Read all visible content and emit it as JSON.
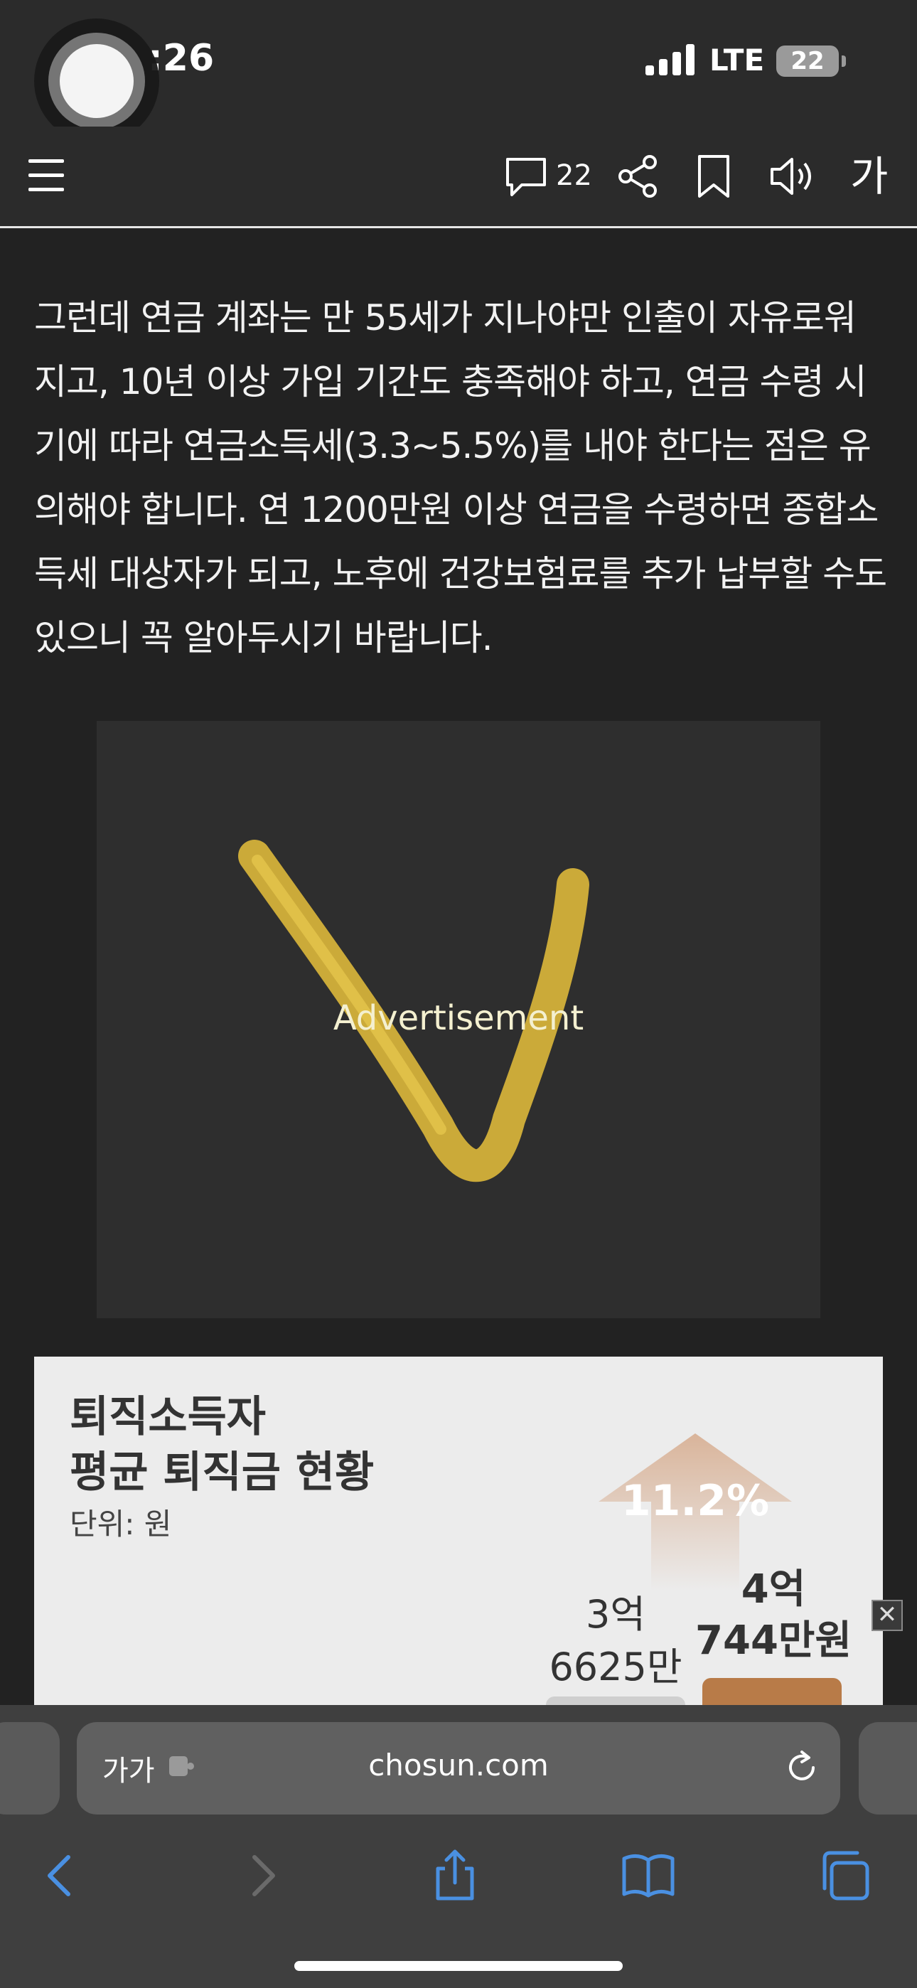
{
  "status_bar": {
    "time": ":26",
    "network": "LTE",
    "battery": "22"
  },
  "toolbar": {
    "comment_count": "22",
    "font_size_label": "가"
  },
  "article": {
    "paragraph": "그런데 연금 계좌는 만 55세가 지나야만 인출이 자유로워지고, 10년 이상 가입 기간도 충족해야 하고, 연금 수령 시기에 따라 연금소득세(3.3~5.5%)를 내야 한다는 점은 유의해야 합니다. 연 1200만원 이상 연금을 수령하면 종합소득세 대상자가 되고, 노후에 건강보험료를 추가 납부할 수도 있으니 꼭 알아두시기 바랍니다."
  },
  "ad": {
    "label": "Advertisement"
  },
  "infographic": {
    "title_line1": "퇴직소득자",
    "title_line2": "평균 퇴직금 현황",
    "unit": "단위: 원",
    "growth": "11.2%",
    "bar1_label_line1": "3억",
    "bar1_label_line2": "6625만",
    "bar2_label_line1": "4억",
    "bar2_label_line2": "744만원"
  },
  "chart_data": {
    "type": "bar",
    "title": "퇴직소득자 평균 퇴직금 현황",
    "unit": "단위: 원",
    "categories": [
      "",
      ""
    ],
    "values": [
      366250000,
      407440000
    ],
    "value_labels": [
      "3억 6625만",
      "4억 744만원"
    ],
    "annotation": "11.2%",
    "colors": [
      "#cfcfcf",
      "#b87b48"
    ]
  },
  "browser": {
    "aa_label": "가가",
    "url": "chosun.com"
  },
  "icons": {
    "menu": "hamburger-icon",
    "comment": "comment-bubble-icon",
    "share": "share-icon",
    "bookmark": "bookmark-icon",
    "sound": "speaker-icon",
    "back": "chevron-left-icon",
    "forward": "chevron-right-icon",
    "share_sheet": "share-sheet-icon",
    "bookmarks": "book-icon",
    "tabs": "tabs-icon",
    "reload": "reload-icon"
  },
  "colors": {
    "background": "#222222",
    "accent_link": "#4a90e2",
    "bar_previous": "#cfcfcf",
    "bar_current": "#b87b48"
  }
}
